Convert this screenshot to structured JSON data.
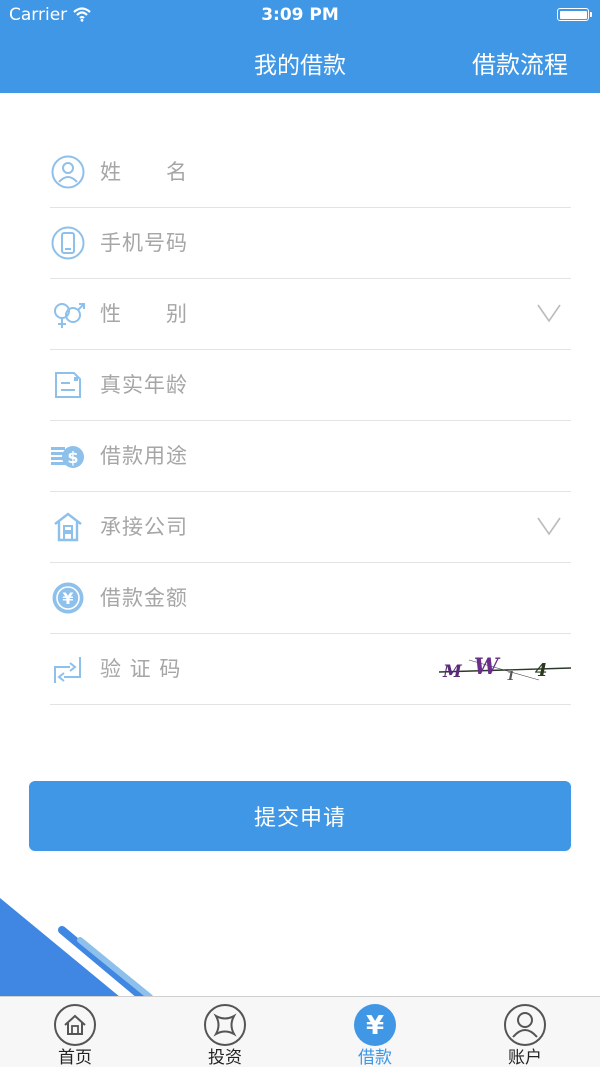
{
  "status_bar": {
    "carrier": "Carrier",
    "time": "3:09 PM"
  },
  "header": {
    "title": "我的借款",
    "flow_link": "借款流程"
  },
  "form": {
    "fields": [
      {
        "label": "姓　　名",
        "icon": "user-icon"
      },
      {
        "label": "手机号码",
        "icon": "phone-icon"
      },
      {
        "label": "性　　别",
        "icon": "gender-icon",
        "dropdown": true
      },
      {
        "label": "真实年龄",
        "icon": "id-card-icon"
      },
      {
        "label": "借款用途",
        "icon": "coins-icon"
      },
      {
        "label": "承接公司",
        "icon": "company-icon",
        "dropdown": true
      },
      {
        "label": "借款金额",
        "icon": "yen-icon"
      },
      {
        "label": "验 证 码",
        "icon": "refresh-icon",
        "captcha": "MW14"
      }
    ]
  },
  "submit_label": "提交申请",
  "tabs": [
    {
      "label": "首页",
      "icon": "home-icon"
    },
    {
      "label": "投资",
      "icon": "invest-icon"
    },
    {
      "label": "借款",
      "icon": "yen-icon",
      "active": true
    },
    {
      "label": "账户",
      "icon": "account-icon"
    }
  ],
  "colors": {
    "primary": "#3f97e6",
    "icon_blue": "#8ec0ec",
    "placeholder": "#a6a6a6"
  }
}
